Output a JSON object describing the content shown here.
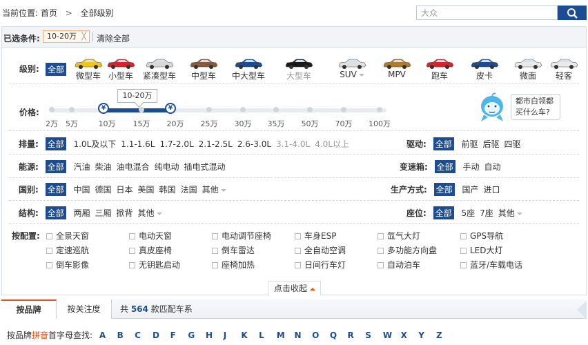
{
  "breadcrumb": {
    "prefix": "当前位置:",
    "home": "首页",
    "separator": ">",
    "current": "全部级别"
  },
  "search": {
    "value": "大众"
  },
  "conditions": {
    "label": "已选条件:",
    "tag": "10-20万",
    "tag_close": "╳",
    "clear": "清除全部"
  },
  "levels": {
    "label": "级别:",
    "all": "全部",
    "items": [
      {
        "label": "微型车",
        "color": "#f0c419"
      },
      {
        "label": "小型车",
        "color": "#d8232a"
      },
      {
        "label": "紧凑型车",
        "color": "#d9d9d9"
      },
      {
        "label": "中型车",
        "color": "#8a5a3c"
      },
      {
        "label": "中大型车",
        "color": "#1c4d92"
      },
      {
        "label": "大型车",
        "color": "#1a1a1a"
      },
      {
        "label": "SUV",
        "color": "#e0e0e0"
      },
      {
        "label": "MPV",
        "color": "#b07a2a"
      },
      {
        "label": "跑车",
        "color": "#d8232a"
      },
      {
        "label": "皮卡",
        "color": "#1c4d92"
      },
      {
        "label": "微面",
        "color": "#eaeaea"
      },
      {
        "label": "轻客",
        "color": "#eaeaea"
      }
    ]
  },
  "price": {
    "label": "价格:",
    "ticks": [
      "2万",
      "5万",
      "10万",
      "15万",
      "20万",
      "25万",
      "30万",
      "35万",
      "50万",
      "70万",
      "100万"
    ],
    "selected_label": "10-20万",
    "handle_symbol": "¥",
    "selected_range": [
      "10万",
      "20万"
    ]
  },
  "mascot": {
    "line1": "都市白领都",
    "line2": "买什么车?"
  },
  "filters": {
    "displacement": {
      "label": "排量:",
      "all": "全部",
      "options": [
        "1.0L及以下",
        "1.1-1.6L",
        "1.7-2.0L",
        "2.1-2.5L",
        "2.6-3.0L"
      ],
      "disabled": [
        "3.1-4.0L",
        "4.0L以上"
      ]
    },
    "drive": {
      "label": "驱动:",
      "all": "全部",
      "options": [
        "前驱",
        "后驱",
        "四驱"
      ]
    },
    "energy": {
      "label": "能源:",
      "all": "全部",
      "options": [
        "汽油",
        "柴油",
        "油电混合",
        "纯电动",
        "插电式混动"
      ]
    },
    "gearbox": {
      "label": "变速箱:",
      "all": "全部",
      "options": [
        "手动",
        "自动"
      ]
    },
    "country": {
      "label": "国别:",
      "all": "全部",
      "options": [
        "中国",
        "德国",
        "日本",
        "美国",
        "韩国",
        "法国",
        "其他"
      ]
    },
    "production": {
      "label": "生产方式:",
      "all": "全部",
      "options": [
        "国产",
        "进口"
      ]
    },
    "structure": {
      "label": "结构:",
      "all": "全部",
      "options": [
        "两厢",
        "三厢",
        "掀背",
        "其他"
      ]
    },
    "seats": {
      "label": "座位:",
      "all": "全部",
      "options": [
        "5座",
        "7座",
        "其他"
      ]
    }
  },
  "config": {
    "label": "按配置:",
    "items": [
      [
        "全景天窗",
        "电动天窗",
        "电动调节座椅",
        "车身ESP",
        "氙气大灯",
        "GPS导航"
      ],
      [
        "定速巡航",
        "真皮座椅",
        "倒车雷达",
        "全自动空调",
        "多功能方向盘",
        "LED大灯"
      ],
      [
        "倒车影像",
        "无钥匙启动",
        "座椅加热",
        "日间行车灯",
        "自动泊车",
        "蓝牙/车载电话"
      ]
    ]
  },
  "collapse": {
    "label": "点击收起"
  },
  "tabs": {
    "brand": "按品牌",
    "attention": "按关注度",
    "count_prefix": "共",
    "count": "564",
    "count_suffix": "款匹配车系"
  },
  "letters": {
    "prefix": "按品牌",
    "highlight": "拼音",
    "suffix": "首字母查找:",
    "items": [
      "A",
      "B",
      "C",
      "D",
      "F",
      "G",
      "H",
      "J",
      "K",
      "L",
      "M",
      "N",
      "O",
      "Q",
      "R",
      "S",
      "W",
      "X",
      "Y",
      "Z"
    ]
  },
  "colors": {
    "accent": "#1c4d92",
    "orange": "#e8541c"
  }
}
